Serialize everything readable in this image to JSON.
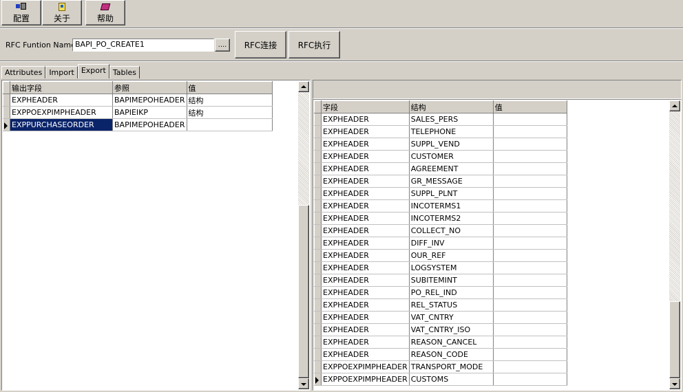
{
  "toolbar": {
    "config_label": "配置",
    "config_icon": "config-icon",
    "about_label": "关于",
    "about_icon": "about-icon",
    "help_label": "帮助",
    "help_icon": "help-icon"
  },
  "rfc": {
    "label": "RFC Funtion Name:",
    "value": "BAPI_PO_CREATE1",
    "browse_label": "....",
    "connect_label": "RFC连接",
    "execute_label": "RFC执行"
  },
  "tabs": [
    {
      "label": "Attributes"
    },
    {
      "label": "Import"
    },
    {
      "label": "Export"
    },
    {
      "label": "Tables"
    }
  ],
  "active_tab": "Export",
  "left_grid": {
    "headers": [
      "输出字段",
      "参照",
      "值"
    ],
    "rows": [
      {
        "field": "EXPHEADER",
        "ref": "BAPIMEPOHEADER",
        "value": "结构"
      },
      {
        "field": "EXPPOEXPIMPHEADER",
        "ref": "BAPIEIKP",
        "value": "结构"
      },
      {
        "field": "EXPPURCHASEORDER",
        "ref": "BAPIMEPOHEADER",
        "value": ""
      }
    ],
    "selected_row": 2
  },
  "right_grid": {
    "headers": [
      "字段",
      "结构",
      "值"
    ],
    "rows": [
      {
        "field": "EXPHEADER",
        "struct": "SALES_PERS",
        "value": ""
      },
      {
        "field": "EXPHEADER",
        "struct": "TELEPHONE",
        "value": ""
      },
      {
        "field": "EXPHEADER",
        "struct": "SUPPL_VEND",
        "value": ""
      },
      {
        "field": "EXPHEADER",
        "struct": "CUSTOMER",
        "value": ""
      },
      {
        "field": "EXPHEADER",
        "struct": "AGREEMENT",
        "value": ""
      },
      {
        "field": "EXPHEADER",
        "struct": "GR_MESSAGE",
        "value": ""
      },
      {
        "field": "EXPHEADER",
        "struct": "SUPPL_PLNT",
        "value": ""
      },
      {
        "field": "EXPHEADER",
        "struct": "INCOTERMS1",
        "value": ""
      },
      {
        "field": "EXPHEADER",
        "struct": "INCOTERMS2",
        "value": ""
      },
      {
        "field": "EXPHEADER",
        "struct": "COLLECT_NO",
        "value": ""
      },
      {
        "field": "EXPHEADER",
        "struct": "DIFF_INV",
        "value": ""
      },
      {
        "field": "EXPHEADER",
        "struct": "OUR_REF",
        "value": ""
      },
      {
        "field": "EXPHEADER",
        "struct": "LOGSYSTEM",
        "value": ""
      },
      {
        "field": "EXPHEADER",
        "struct": "SUBITEMINT",
        "value": ""
      },
      {
        "field": "EXPHEADER",
        "struct": "PO_REL_IND",
        "value": ""
      },
      {
        "field": "EXPHEADER",
        "struct": "REL_STATUS",
        "value": ""
      },
      {
        "field": "EXPHEADER",
        "struct": "VAT_CNTRY",
        "value": ""
      },
      {
        "field": "EXPHEADER",
        "struct": "VAT_CNTRY_ISO",
        "value": ""
      },
      {
        "field": "EXPHEADER",
        "struct": "REASON_CANCEL",
        "value": ""
      },
      {
        "field": "EXPHEADER",
        "struct": "REASON_CODE",
        "value": ""
      },
      {
        "field": "EXPPOEXPIMPHEADER",
        "struct": "TRANSPORT_MODE",
        "value": ""
      },
      {
        "field": "EXPPOEXPIMPHEADER",
        "struct": "CUSTOMS",
        "value": ""
      }
    ],
    "current_row": 21
  },
  "colors": {
    "face": "#d4d0c8",
    "selection": "#0a246a"
  }
}
